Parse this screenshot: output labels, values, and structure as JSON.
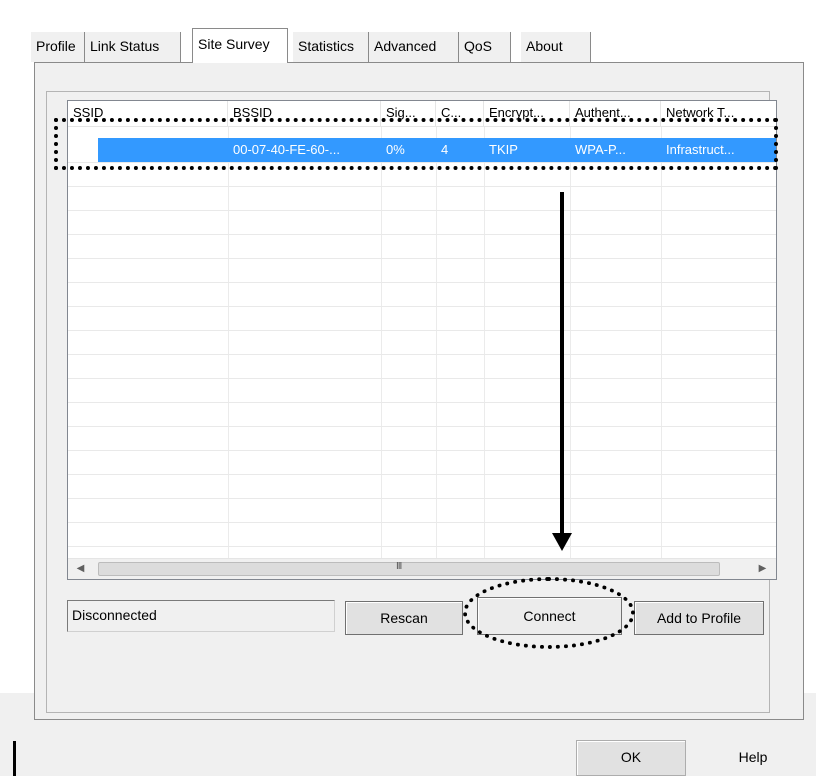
{
  "tabs": [
    {
      "label": "Profile",
      "active": false
    },
    {
      "label": "Link Status",
      "active": false
    },
    {
      "label": "Site Survey",
      "active": true
    },
    {
      "label": "Statistics",
      "active": false
    },
    {
      "label": "Advanced",
      "active": false
    },
    {
      "label": "QoS",
      "active": false
    },
    {
      "label": "About",
      "active": false
    }
  ],
  "table": {
    "columns": [
      "SSID",
      "BSSID",
      "Sig...",
      "C...",
      "Encrypt...",
      "Authent...",
      "Network T..."
    ],
    "rows": [
      {
        "selected": true,
        "cells": [
          "",
          "00-07-40-FE-60-...",
          "0%",
          "4",
          "TKIP",
          "WPA-P...",
          "Infrastruct..."
        ]
      }
    ],
    "scrollbar": {
      "grip": "III"
    }
  },
  "status": {
    "text": "Disconnected"
  },
  "buttons": {
    "rescan": "Rescan",
    "connect": "Connect",
    "add_to_profile": "Add to Profile",
    "ok": "OK",
    "help": "Help"
  },
  "colors": {
    "selection": "#3399ff",
    "panel": "#f0f0f0"
  },
  "annotations": {
    "row_highlight": "dotted-rectangle",
    "connect_highlight": "dotted-oval",
    "arrow": "down-arrow"
  }
}
